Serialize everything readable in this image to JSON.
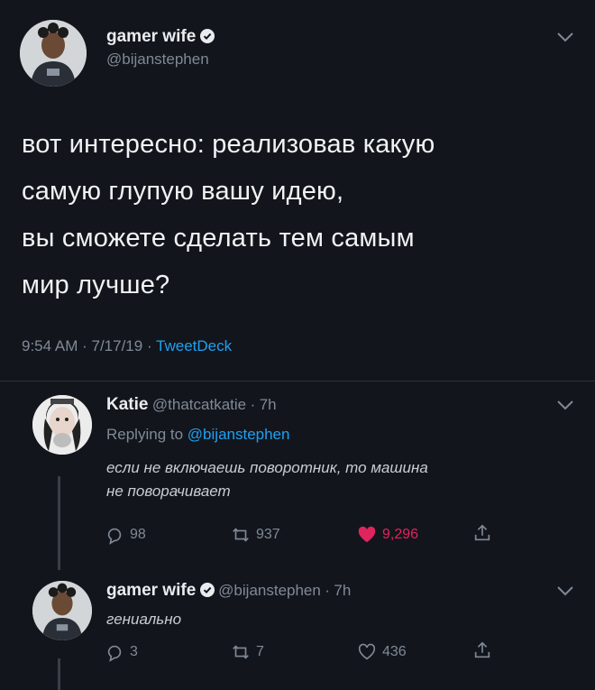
{
  "main_tweet": {
    "author_name": "gamer wife",
    "author_handle": "@bijanstephen",
    "text_lines": [
      "вот интересно: реализовав какую",
      "самую глупую вашу идею,",
      "вы сможете сделать тем самым",
      "мир лучше?"
    ],
    "time": "9:54 AM",
    "date": "7/17/19",
    "source": "TweetDeck"
  },
  "reply1": {
    "author_name": "Katie",
    "author_handle": "@thatcatkatie",
    "age": "7h",
    "replying_prefix": "Replying to",
    "replying_handle": "@bijanstephen",
    "text_lines": [
      "если не включаешь поворотник, то машина",
      "не поворачивает"
    ],
    "replies": "98",
    "retweets": "937",
    "likes": "9,296"
  },
  "reply2": {
    "author_name": "gamer wife",
    "author_handle": "@bijanstephen",
    "age": "7h",
    "text": "гениально",
    "replies": "3",
    "retweets": "7",
    "likes": "436"
  },
  "colors": {
    "background": "#13151c",
    "link": "#1da1f2",
    "like": "#e0245e",
    "muted": "#7f8a96"
  },
  "icons": [
    "verified-icon",
    "chevron-down-icon",
    "reply-icon",
    "retweet-icon",
    "heart-icon",
    "share-icon"
  ]
}
